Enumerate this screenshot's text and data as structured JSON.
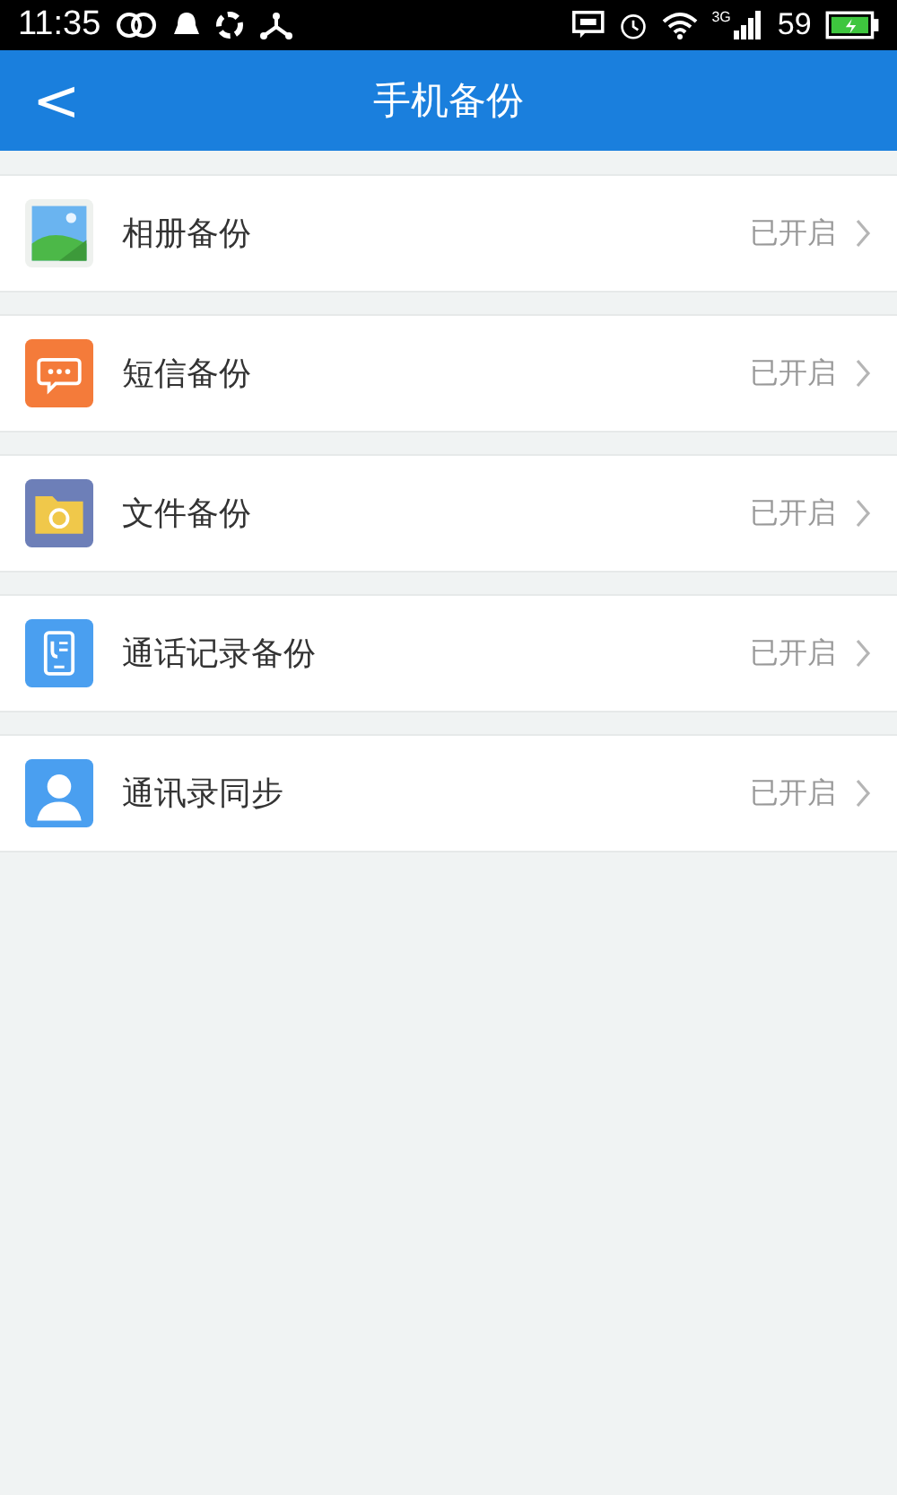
{
  "status_bar": {
    "time": "11:35",
    "network": "3G",
    "battery": "59"
  },
  "header": {
    "back": "<",
    "title": "手机备份"
  },
  "items": [
    {
      "kind": "photo",
      "label": "相册备份",
      "status": "已开启"
    },
    {
      "kind": "sms",
      "label": "短信备份",
      "status": "已开启"
    },
    {
      "kind": "file",
      "label": "文件备份",
      "status": "已开启"
    },
    {
      "kind": "calllog",
      "label": "通话记录备份",
      "status": "已开启"
    },
    {
      "kind": "contacts",
      "label": "通讯录同步",
      "status": "已开启"
    }
  ]
}
